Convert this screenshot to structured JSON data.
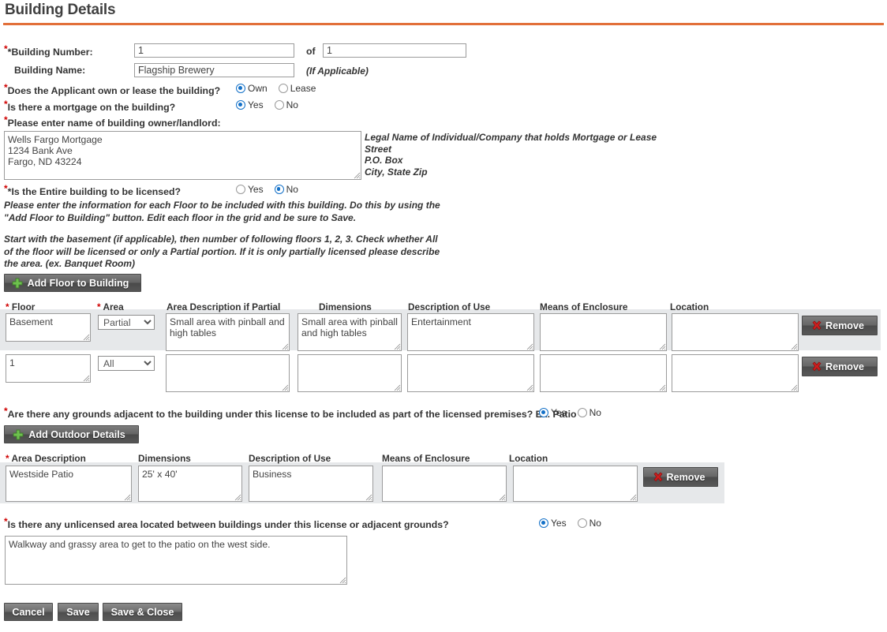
{
  "page": {
    "title": "Building Details",
    "rule_color": "#E2703A"
  },
  "fields": {
    "building_number_label": "*Building Number:",
    "building_number_value": "1",
    "of_label": "of",
    "building_total_value": "1",
    "building_name_label": "Building Name:",
    "building_name_value": "Flagship Brewery",
    "if_applicable": "(If Applicable)"
  },
  "questions": {
    "own_or_lease": {
      "label": "Does the Applicant own or lease the building?",
      "options": [
        "Own",
        "Lease"
      ],
      "selected": "Own"
    },
    "mortgage": {
      "label": "Is there a mortgage on the building?",
      "options": [
        "Yes",
        "No"
      ],
      "selected": "Yes"
    },
    "owner_name": {
      "label": "Please enter name of building owner/landlord:",
      "value": "Wells Fargo Mortgage\n1234 Bank Ave\nFargo, ND 43224",
      "hint_lines": [
        "Legal Name of Individual/Company that holds Mortgage or Lease",
        "Street",
        "P.O. Box",
        "City, State Zip"
      ]
    },
    "entire_building": {
      "label": "*Is the Entire building to be licensed?",
      "options": [
        "Yes",
        "No"
      ],
      "selected": "No"
    },
    "grounds_adjacent": {
      "label": "Are there any grounds adjacent to the building under this license to be included as part of the licensed premises? Ex. Patio",
      "options": [
        "Yes",
        "No"
      ],
      "selected": "Yes"
    },
    "unlicensed_area": {
      "label": "Is there any unlicensed area located between buildings under this license or adjacent grounds?",
      "options": [
        "Yes",
        "No"
      ],
      "selected": "Yes",
      "value": "Walkway and grassy area to get to the patio on the west side."
    }
  },
  "instructions": {
    "para1_line1": "Please enter the information for each Floor to be included with this building. Do this by using the",
    "para1_line2": "\"Add Floor to Building\" button. Edit each floor in the grid and be sure to Save.",
    "para2_line1": "Start with the basement (if applicable), then number of following floors 1, 2, 3. Check whether All",
    "para2_line2": "of the floor will be licensed or only a Partial portion. If it is only partially licensed please describe",
    "para2_line3": "the area. (ex. Banquet Room)"
  },
  "floor_grid": {
    "add_button_label": "Add Floor to Building",
    "add_button_icon": "plus-icon",
    "headers": {
      "floor": "Floor",
      "area": "Area",
      "area_description": "Area Description if Partial",
      "dimensions": "Dimensions",
      "description_of_use": "Description of Use",
      "means_of_enclosure": "Means of Enclosure",
      "location": "Location"
    },
    "area_options": [
      "All",
      "Partial"
    ],
    "remove_label": "Remove",
    "remove_icon": "red-x-icon",
    "rows": [
      {
        "floor": "Basement",
        "area": "Partial",
        "area_description": "Small area with pinball and high tables",
        "dimensions": "Small area with pinball and high tables",
        "description_of_use": "Entertainment",
        "means_of_enclosure": "",
        "location": "",
        "selected": true
      },
      {
        "floor": "1",
        "area": "All",
        "area_description": "",
        "dimensions": "",
        "description_of_use": "",
        "means_of_enclosure": "",
        "location": "",
        "selected": false
      }
    ]
  },
  "outdoor_grid": {
    "add_button_label": "Add Outdoor Details",
    "add_button_icon": "plus-icon",
    "headers": {
      "area_description": "Area Description",
      "dimensions": "Dimensions",
      "description_of_use": "Description of Use",
      "means_of_enclosure": "Means of Enclosure",
      "location": "Location"
    },
    "remove_label": "Remove",
    "remove_icon": "red-x-icon",
    "rows": [
      {
        "area_description": "Westside Patio",
        "dimensions": "25' x 40'",
        "description_of_use": "Business",
        "means_of_enclosure": "",
        "location": ""
      }
    ]
  },
  "footer": {
    "cancel": "Cancel",
    "save": "Save",
    "save_close": "Save & Close"
  }
}
